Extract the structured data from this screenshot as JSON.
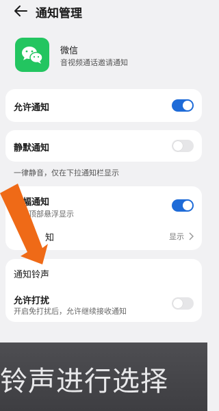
{
  "header": {
    "title": "通知管理"
  },
  "app": {
    "name": "微信",
    "subtitle": "音视频通话邀请通知"
  },
  "allow_notifications": {
    "label": "允许通知",
    "enabled": true
  },
  "silent_notifications": {
    "label": "静默通知",
    "enabled": false,
    "note": "一律静音，仅在下拉通知栏显示"
  },
  "banner_notifications": {
    "label": "横幅通知",
    "subtitle": "屏幕顶部悬浮显示",
    "enabled": true
  },
  "partial_row": {
    "label": "知",
    "value": "显示"
  },
  "ringtone": {
    "label": "通知铃声"
  },
  "allow_dnd": {
    "label": "允许打扰",
    "subtitle": "开启免打扰后，允许继续接收通知",
    "enabled": false
  },
  "overlay": {
    "caption": "铃声进行选择"
  },
  "colors": {
    "accent": "#1e6bd8",
    "wechat_green": "#23c560",
    "arrow": "#ef6a17"
  },
  "icons": [
    "back-arrow-icon",
    "wechat-icon",
    "chevron-right-icon",
    "pointer-arrow-icon"
  ]
}
